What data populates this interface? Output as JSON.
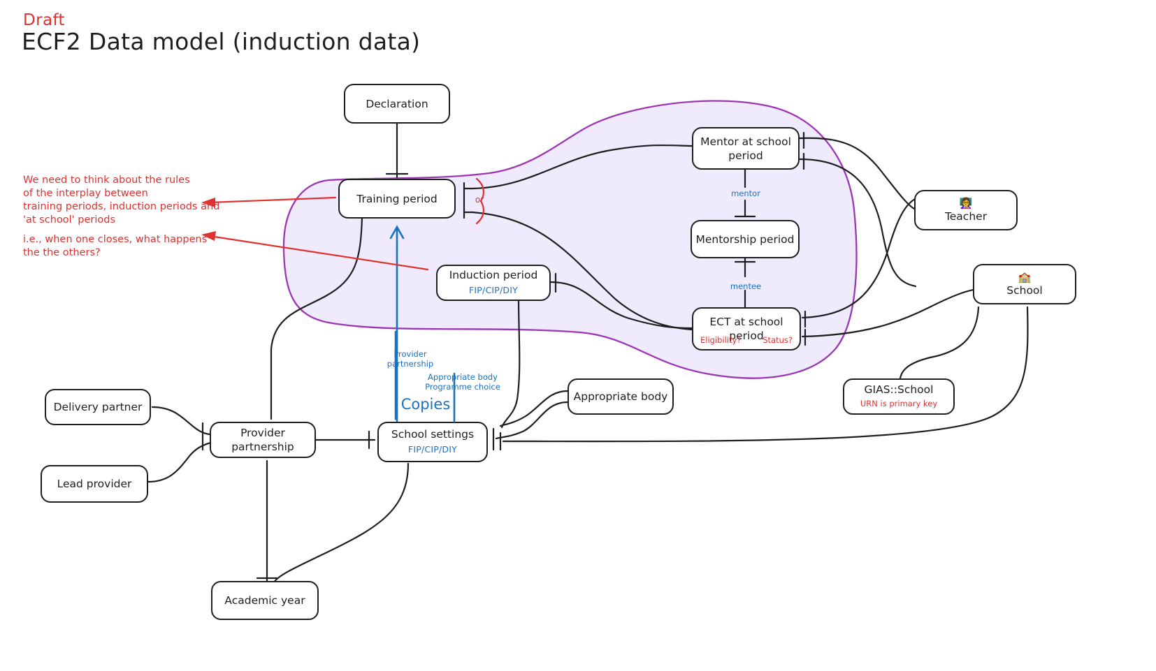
{
  "header": {
    "draft_label": "Draft",
    "title": "ECF2 Data model (induction data)"
  },
  "annotations": [
    {
      "id": "interplay-note",
      "color": "#e03131",
      "text": "We need to think about the rules\nof the interplay between\ntraining periods, induction periods and\n'at school' periods"
    },
    {
      "id": "closure-note",
      "color": "#e03131",
      "text": "i.e., when one closes, what happens\nthe the others?"
    }
  ],
  "group": {
    "name": "periods-group",
    "stroke": "#9c36b5",
    "fill": "#efeafc"
  },
  "nodes": [
    {
      "id": "declaration",
      "label": "Declaration"
    },
    {
      "id": "training-period",
      "label": "Training period"
    },
    {
      "id": "induction-period",
      "label": "Induction period",
      "sub": "FIP/CIP/DIY"
    },
    {
      "id": "mentor-at-school",
      "label": "Mentor at school period"
    },
    {
      "id": "mentorship-period",
      "label": "Mentorship period"
    },
    {
      "id": "ect-at-school",
      "label": "ECT at school period",
      "red_left": "Eligibility?",
      "red_right": "Status?"
    },
    {
      "id": "teacher",
      "label": "Teacher",
      "icon": "teacher-emoji"
    },
    {
      "id": "school",
      "label": "School",
      "icon": "school-emoji"
    },
    {
      "id": "gias-school",
      "label": "GIAS::School",
      "sub_red": "URN is primary key"
    },
    {
      "id": "appropriate-body",
      "label": "Appropriate body"
    },
    {
      "id": "delivery-partner",
      "label": "Delivery partner"
    },
    {
      "id": "lead-provider",
      "label": "Lead provider"
    },
    {
      "id": "provider-partnership",
      "label": "Provider partnership"
    },
    {
      "id": "school-settings",
      "label": "School settings",
      "sub": "FIP/CIP/DIY"
    },
    {
      "id": "academic-year",
      "label": "Academic year"
    }
  ],
  "edge_labels": [
    {
      "id": "or-label",
      "text": "or",
      "color": "#e03131"
    },
    {
      "id": "mentor-label",
      "text": "mentor",
      "color": "#1971c2"
    },
    {
      "id": "mentee-label",
      "text": "mentee",
      "color": "#1971c2"
    },
    {
      "id": "provider-partnership-label",
      "text": "Provider\npartnership",
      "color": "#1971c2"
    },
    {
      "id": "appropriate-body-label",
      "text": "Appropriate body\nProgramme choice",
      "color": "#1971c2"
    },
    {
      "id": "copies-label",
      "text": "Copies",
      "color": "#1971c2"
    }
  ],
  "icons": {
    "teacher_emoji": "👩‍🏫",
    "school_emoji": "🏫"
  }
}
